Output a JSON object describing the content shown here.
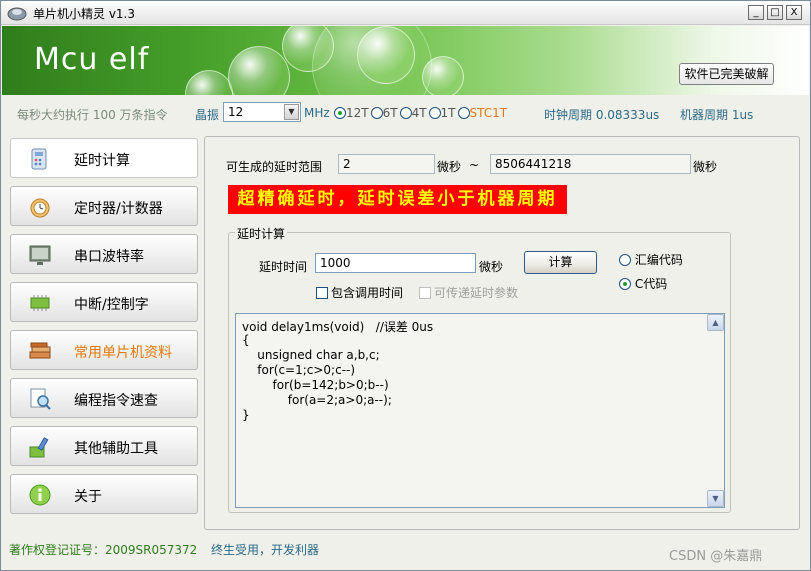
{
  "window": {
    "title": "单片机小精灵  v1.3",
    "controls": {
      "minimize": "_",
      "maximize": "□",
      "close": "X"
    }
  },
  "banner": {
    "title": "Mcu elf",
    "crack_button": "软件已完美破解"
  },
  "infobar": {
    "speed_text": "每秒大约执行 100 万条指令",
    "crystal_label": "晶振",
    "crystal_value": "12",
    "mhz_unit": "MHz",
    "modes": [
      {
        "label": "12T",
        "selected": true
      },
      {
        "label": "6T",
        "selected": false
      },
      {
        "label": "4T",
        "selected": false
      },
      {
        "label": "1T",
        "selected": false
      },
      {
        "label": "STC1T",
        "selected": false
      }
    ],
    "clock_period": "时钟周期 0.08333us",
    "machine_period": "机器周期 1us"
  },
  "nav": {
    "items": [
      {
        "label": "延时计算",
        "icon": "calculator-icon",
        "active": true
      },
      {
        "label": "定时器/计数器",
        "icon": "alarm-clock-icon",
        "active": false
      },
      {
        "label": "串口波特率",
        "icon": "monitor-icon",
        "active": false
      },
      {
        "label": "中断/控制字",
        "icon": "chip-icon",
        "active": false
      },
      {
        "label": "常用单片机资料",
        "icon": "books-icon",
        "active": false,
        "highlight": true
      },
      {
        "label": "编程指令速查",
        "icon": "magnifier-document-icon",
        "active": false
      },
      {
        "label": "其他辅助工具",
        "icon": "tools-icon",
        "active": false
      },
      {
        "label": "关于",
        "icon": "info-icon",
        "active": false
      }
    ]
  },
  "delay": {
    "range_label": "可生成的延时范围",
    "range_min": "2",
    "range_unit_1": "微秒",
    "range_sep": "~",
    "range_max": "8506441218",
    "range_unit_2": "微秒",
    "precision_banner": "超精确延时，延时误差小于机器周期",
    "group_title": "延时计算",
    "time_label": "延时时间",
    "time_value": "1000",
    "time_unit": "微秒",
    "calc_button": "计算",
    "code_options": [
      {
        "label": "汇编代码",
        "selected": false
      },
      {
        "label": "C代码",
        "selected": true
      }
    ],
    "include_call_label": "包含调用时间",
    "pass_param_label": "可传递延时参数",
    "code_lines": [
      "void delay1ms(void)   //误差 0us",
      "{",
      "    unsigned char a,b,c;",
      "    for(c=1;c>0;c--)",
      "        for(b=142;b>0;b--)",
      "            for(a=2;a>0;a--);",
      "}"
    ]
  },
  "status": {
    "copyright": "著作权登记证号：2009SR057372",
    "slogan": "终生受用，开发利器",
    "watermark": "CSDN @朱嘉鼎"
  },
  "colors": {
    "banner_green": "#47a12a",
    "precision_bg": "#ff0000",
    "precision_fg": "#ffff00",
    "highlight_orange": "#e07a10",
    "status_green": "#2f7d1c"
  }
}
